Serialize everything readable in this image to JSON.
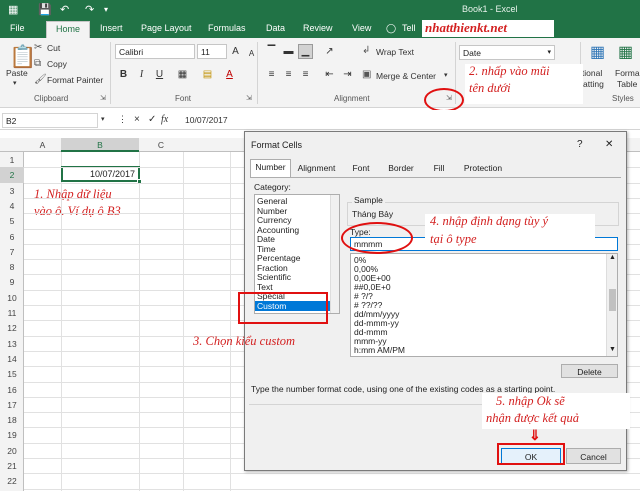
{
  "titlebar": {
    "doc_title": "Book1 - Excel",
    "tell_me": "Tell"
  },
  "tabs": [
    "File",
    "Home",
    "Insert",
    "Page Layout",
    "Formulas",
    "Data",
    "Review",
    "View"
  ],
  "watermark": "nhatthienkt.net",
  "ribbon": {
    "clipboard": {
      "paste": "Paste",
      "cut": "Cut",
      "copy": "Copy",
      "format_painter": "Format Painter",
      "label": "Clipboard"
    },
    "font": {
      "name": "Calibri",
      "size": "11",
      "label": "Font",
      "bold": "B",
      "italic": "I",
      "underline": "U",
      "grow": "A",
      "shrink": "A",
      "font_color": "A"
    },
    "alignment": {
      "wrap_text": "Wrap Text",
      "merge_center": "Merge & Center",
      "label": "Alignment"
    },
    "number": {
      "format": "Date",
      "percent": "%",
      "comma": ",",
      "dec_inc": ".00",
      "dec_dec": ".0"
    },
    "styles": {
      "conditional": "itional",
      "conditional2": "atting",
      "format_as": "Forma",
      "format_as2": "Table",
      "label": "Styles"
    }
  },
  "formula_bar": {
    "name_box": "B2",
    "cancel": "×",
    "enter": "✓",
    "fx": "fx",
    "value": "10/07/2017"
  },
  "sheet": {
    "columns": [
      "A",
      "B",
      "C"
    ],
    "rows": [
      "1",
      "2",
      "3",
      "4",
      "5",
      "6",
      "7",
      "8",
      "9",
      "10",
      "11",
      "12",
      "13",
      "14",
      "15",
      "16",
      "17",
      "18",
      "19",
      "20",
      "21",
      "22"
    ],
    "cell_b2": "10/07/2017"
  },
  "dialog": {
    "title": "Format Cells",
    "help": "?",
    "close": "✕",
    "tabs": [
      "Number",
      "Alignment",
      "Font",
      "Border",
      "Fill",
      "Protection"
    ],
    "category_label": "Category:",
    "categories": [
      "General",
      "Number",
      "Currency",
      "Accounting",
      "Date",
      "Time",
      "Percentage",
      "Fraction",
      "Scientific",
      "Text",
      "Special",
      "Custom"
    ],
    "selected_category": "Custom",
    "sample_label": "Sample",
    "sample_value": "Tháng Bảy",
    "type_label": "Type:",
    "type_value": "mmmm",
    "codes": [
      "0%",
      "0,00%",
      "0,00E+00",
      "##0,0E+0",
      "# ?/?",
      "# ??/??",
      "dd/mm/yyyy",
      "dd-mmm-yy",
      "dd-mmm",
      "mmm-yy",
      "h:mm AM/PM"
    ],
    "delete_button": "Delete",
    "hint": "Type the number format code, using one of the existing codes as a starting point.",
    "ok_button": "OK",
    "cancel_button": "Cancel"
  },
  "annotations": {
    "a1": "1. Nhập dữ liệu",
    "a1b": "vào ô. Ví dụ ô B3",
    "a2": "2. nhấp vào mũi",
    "a2b": "tên dưới",
    "a3": "3. Chọn kiểu custom",
    "a4": "4. nhập định dạng tùy ý",
    "a4b": "tại ô type",
    "a5": "5. nhập Ok sẽ",
    "a5b": "nhận được kết quả"
  },
  "colors": {
    "excel_green": "#217346",
    "annotation_red": "#d32020",
    "selection_blue": "#0078d7"
  }
}
